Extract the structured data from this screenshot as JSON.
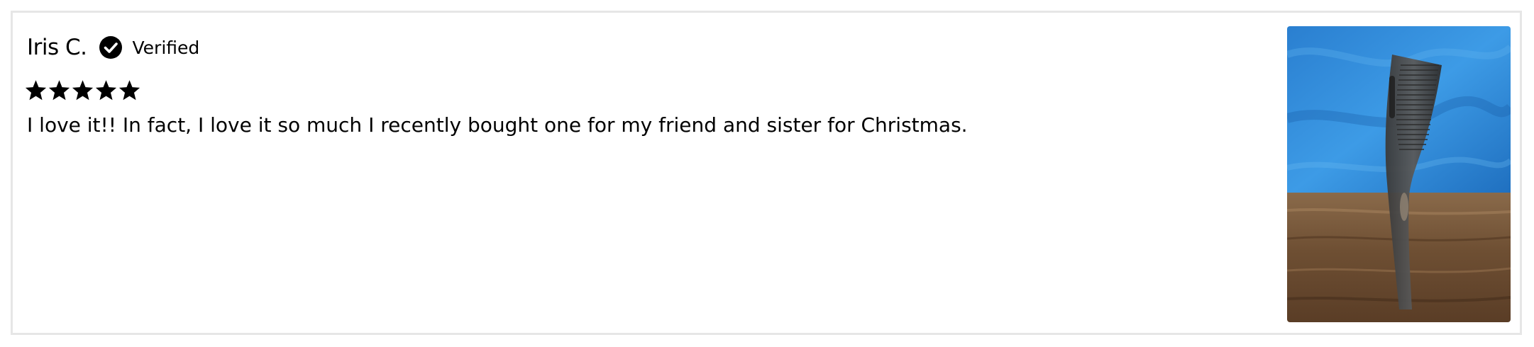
{
  "review": {
    "reviewer_name": "Iris C.",
    "verified_label": "Verified",
    "verified_icon": "check-circle-icon",
    "rating": 5,
    "rating_max": 5,
    "text": "I love it!! In fact, I love it so much I recently bought one for my friend and sister for Christmas.",
    "photo": "review-photo-comb"
  },
  "colors": {
    "text": "#000000",
    "border": "#e6e6e6",
    "star": "#000000"
  }
}
